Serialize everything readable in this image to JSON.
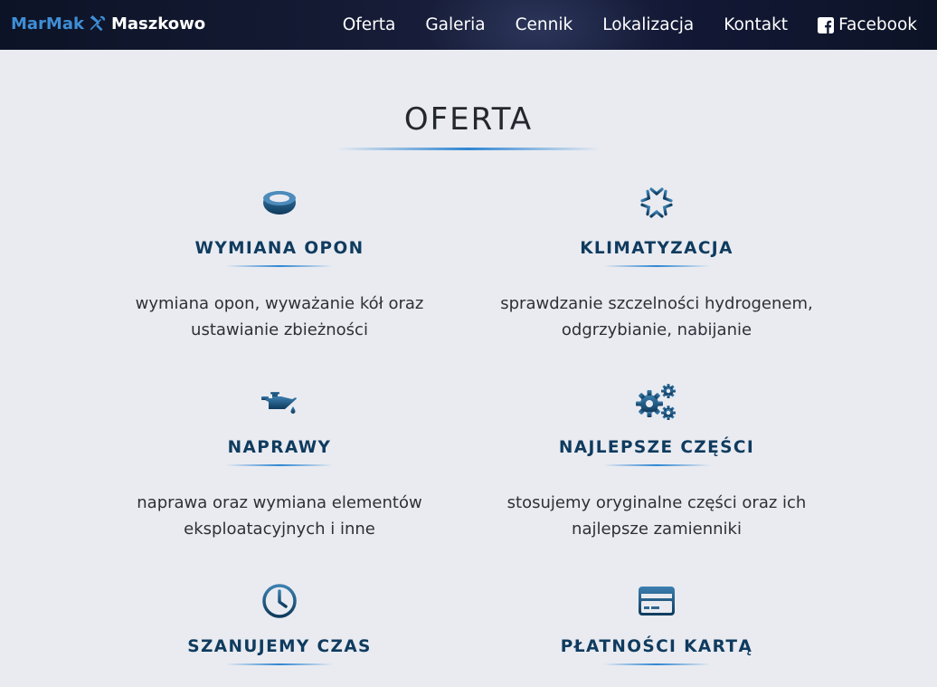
{
  "brand": {
    "part1": "MarMak",
    "part2": "Maszkowo",
    "icon": "wrench-screwdriver-icon"
  },
  "nav": {
    "items": [
      {
        "label": "Oferta"
      },
      {
        "label": "Galeria"
      },
      {
        "label": "Cennik"
      },
      {
        "label": "Lokalizacja"
      },
      {
        "label": "Kontakt"
      },
      {
        "label": "Facebook",
        "icon": "facebook-icon"
      }
    ]
  },
  "main": {
    "title": "OFERTA",
    "services": [
      {
        "icon": "tire-icon",
        "title": "WYMIANA OPON",
        "desc_line1": "wymiana opon, wyważanie kół oraz",
        "desc_line2": "ustawianie zbieżności"
      },
      {
        "icon": "snowflake-icon",
        "title": "KLIMATYZACJA",
        "desc_line1": "sprawdzanie szczelności hydrogenem,",
        "desc_line2": "odgrzybianie, nabijanie"
      },
      {
        "icon": "oil-can-icon",
        "title": "NAPRAWY",
        "desc_line1": "naprawa oraz wymiana elementów",
        "desc_line2": "eksploatacyjnych i inne"
      },
      {
        "icon": "cogs-icon",
        "title": "NAJLEPSZE CZĘŚCI",
        "desc_line1": "stosujemy oryginalne części oraz ich",
        "desc_line2": "najlepsze zamienniki"
      },
      {
        "icon": "clock-icon",
        "title": "SZANUJEMY CZAS",
        "desc_line1": "",
        "desc_line2": ""
      },
      {
        "icon": "credit-card-icon",
        "title": "PŁATNOŚCI KARTĄ",
        "desc_line1": "",
        "desc_line2": ""
      }
    ]
  },
  "colors": {
    "brand_blue": "#3f8ed6",
    "heading_navy": "#0f3b5e",
    "icon_gradient_start": "#3a78a8",
    "icon_gradient_end": "#0d3a5c",
    "background": "#e9ebf1"
  }
}
